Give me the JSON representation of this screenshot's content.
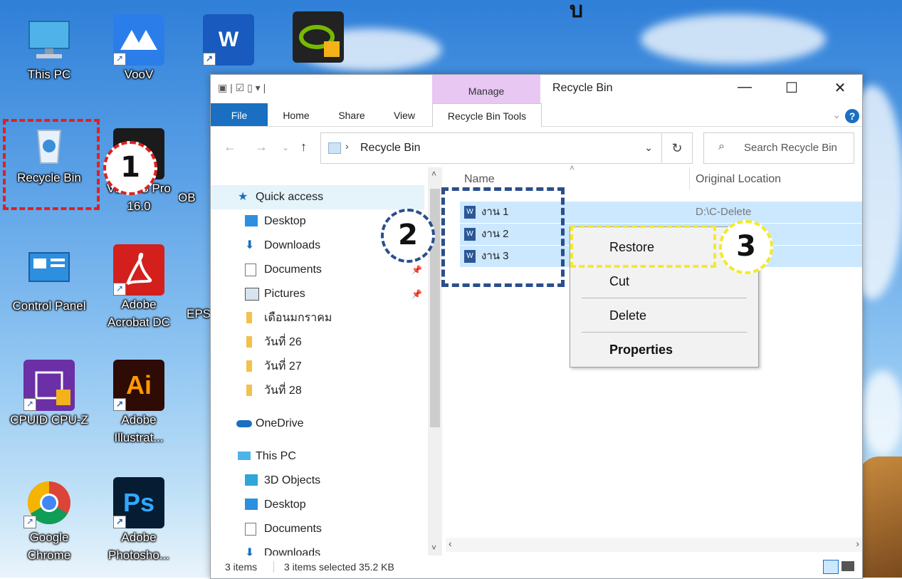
{
  "desktop": {
    "top_char": "บ",
    "icons": [
      {
        "label": "This PC",
        "icon": "this-pc-icon"
      },
      {
        "label": "VooV",
        "icon": "voov-icon"
      },
      {
        "label": "",
        "icon": "word-icon"
      },
      {
        "label": "",
        "icon": "nvidia-icon"
      },
      {
        "label": "Recycle Bin",
        "icon": "recycle-bin-icon"
      },
      {
        "label": "VEGAS Pro 16.0",
        "label_line1": "VEGAS Pro",
        "label_line2": "16.0",
        "icon": "vegas-icon"
      },
      {
        "label": "OB",
        "icon": "obs-icon"
      },
      {
        "label": "Control Panel",
        "icon": "control-panel-icon"
      },
      {
        "label": "Adobe Acrobat DC",
        "label_line1": "Adobe",
        "label_line2": "Acrobat DC",
        "icon": "acrobat-icon"
      },
      {
        "label": "EPS",
        "icon": "epson-icon"
      },
      {
        "label": "CPUID CPU-Z",
        "icon": "cpuz-icon"
      },
      {
        "label": "Adobe Illustrat...",
        "label_line1": "Adobe",
        "label_line2": "Illustrat...",
        "icon": "illustrator-icon"
      },
      {
        "label": "Google Chrome",
        "label_line1": "Google",
        "label_line2": "Chrome",
        "icon": "chrome-icon"
      },
      {
        "label": "Adobe Photosho...",
        "label_line1": "Adobe",
        "label_line2": "Photosho...",
        "icon": "photoshop-icon"
      }
    ]
  },
  "window": {
    "title": "Recycle Bin",
    "manage_tab": "Manage",
    "ribbon_tabs": [
      "File",
      "Home",
      "Share",
      "View"
    ],
    "context_tab": "Recycle Bin Tools",
    "address_path": "Recycle Bin",
    "search_placeholder": "Search Recycle Bin",
    "columns": {
      "name": "Name",
      "location": "Original Location"
    },
    "files": [
      {
        "name": "งาน 1",
        "location": "D:\\C-Delete"
      },
      {
        "name": "งาน 2",
        "location": ""
      },
      {
        "name": "งาน 3",
        "location": ""
      }
    ],
    "nav": {
      "quick_access": "Quick access",
      "desktop": "Desktop",
      "downloads": "Downloads",
      "documents": "Documents",
      "pictures": "Pictures",
      "folder1": "เดือนมกราคม",
      "folder2": "วันที่ 26",
      "folder3": "วันที่ 27",
      "folder4": "วันที่ 28",
      "onedrive": "OneDrive",
      "this_pc": "This PC",
      "objects3d": "3D Objects",
      "desktop2": "Desktop",
      "documents2": "Documents",
      "downloads2": "Downloads"
    },
    "status": {
      "items": "3 items",
      "selected": "3 items selected  35.2 KB"
    }
  },
  "context_menu": {
    "restore": "Restore",
    "cut": "Cut",
    "delete": "Delete",
    "properties": "Properties"
  },
  "annotations": {
    "step1": "1",
    "step2": "2",
    "step3": "3"
  },
  "colors": {
    "accent": "#1a6fc1",
    "selection": "#cce8ff",
    "marker_red": "#e02020",
    "marker_blue": "#2a4f8c",
    "marker_yellow": "#f2ea2a"
  }
}
